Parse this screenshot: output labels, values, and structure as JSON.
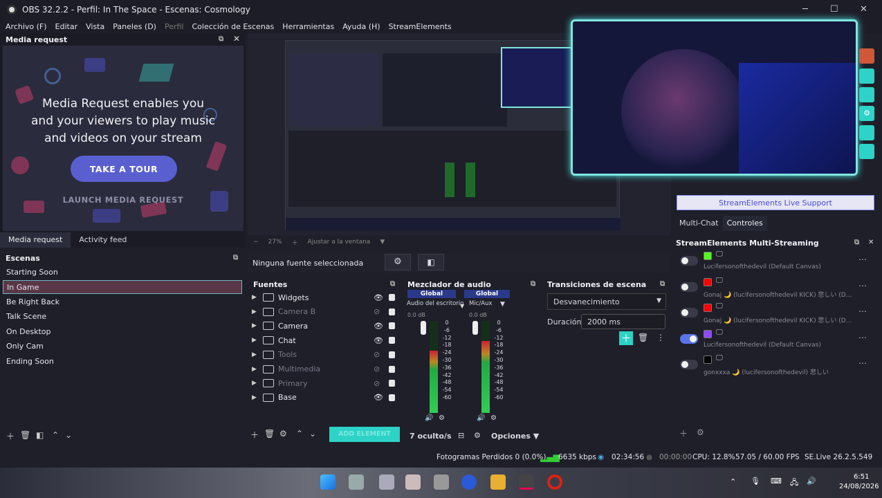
{
  "window": {
    "title": "OBS 32.2.2 - Perfil: In The Space - Escenas: Cosmology"
  },
  "menu": [
    "Archivo (F)",
    "Editar",
    "Vista",
    "Paneles (D)",
    "Perfil",
    "Colección de Escenas",
    "Herramientas",
    "Ayuda (H)",
    "StreamElements"
  ],
  "media_request": {
    "dock_title": "Media request",
    "headline": [
      "Media Request enables you",
      "and your viewers to play music",
      "and videos on your stream"
    ],
    "tour_button": "TAKE A TOUR",
    "launch_link": "LAUNCH MEDIA REQUEST",
    "tabs": [
      "Media request",
      "Activity feed"
    ]
  },
  "scenes": {
    "title": "Escenas",
    "items": [
      "Starting Soon",
      "In Game",
      "Be Right Back",
      "Talk Scene",
      "On Desktop",
      "Only Cam",
      "Ending Soon"
    ],
    "selected": "In Game"
  },
  "preview": {
    "zoom": "27%",
    "fit_label": "Ajustar a la ventana"
  },
  "source_toolbar": {
    "no_source": "Ninguna fuente seleccionada"
  },
  "sources": {
    "title": "Fuentes",
    "items": [
      {
        "name": "Widgets",
        "visible": true
      },
      {
        "name": "Camera B",
        "visible": false
      },
      {
        "name": "Camera",
        "visible": true
      },
      {
        "name": "Chat",
        "visible": true
      },
      {
        "name": "Tools",
        "visible": false
      },
      {
        "name": "Multimedia",
        "visible": false
      },
      {
        "name": "Primary",
        "visible": false
      },
      {
        "name": "Base",
        "visible": true
      }
    ],
    "add_element": "ADD ELEMENT",
    "hidden_count": "7 oculto/s",
    "options": "Opciones"
  },
  "mixer": {
    "title": "Mezclador de audio",
    "channels": [
      {
        "scope": "Global",
        "name": "Audio del escritorio",
        "db": "0.0 dB"
      },
      {
        "scope": "Global",
        "name": "Mic/Aux",
        "db": "0.0 dB"
      }
    ],
    "scale": [
      "0",
      "-6",
      "-12",
      "-18",
      "-24",
      "-30",
      "-36",
      "-42",
      "-48",
      "-54",
      "-60"
    ]
  },
  "transitions": {
    "title": "Transiciones de escena",
    "selected": "Desvanecimiento",
    "duration_label": "Duración",
    "duration_value": "2000 ms"
  },
  "streamelements": {
    "live_support": "StreamElements Live Support",
    "tabs": [
      "Multi-Chat",
      "Controles"
    ],
    "multistream_title": "StreamElements Multi-Streaming",
    "rows": [
      {
        "platform": "kick",
        "account": "Lucifersonofthedevil (Default Canvas)",
        "on": false,
        "color": "#53fc18"
      },
      {
        "platform": "youtube",
        "account": "Gonaj 🌙 (lucifersonofthedevil KICK) 悲しい (D...",
        "on": false,
        "color": "#ff0000"
      },
      {
        "platform": "youtube",
        "account": "Gonaj 🌙 (lucifersonofthedevil KICK) 悲しい (D...",
        "on": false,
        "color": "#ff0000"
      },
      {
        "platform": "twitch",
        "account": "Lucifersonofthedevil (Default Canvas)",
        "on": true,
        "color": "#9146ff"
      },
      {
        "platform": "x",
        "account": "gonxxxa 🌙 (lucifersonofthedevil) 悲しい",
        "on": false,
        "color": "#000000"
      }
    ]
  },
  "status": {
    "dropped": "Fotogramas Perdidos 0 (0.0%)",
    "bitrate": "6635 kbps",
    "live_time": "02:34:56",
    "rec_time": "00:00:00",
    "cpu": "CPU: 12.8%",
    "fps": "57.05 / 60.00 FPS",
    "version": "SE.Live 26.2.5.549"
  },
  "taskbar": {
    "time": "6:51",
    "date": "24/08/2026"
  }
}
